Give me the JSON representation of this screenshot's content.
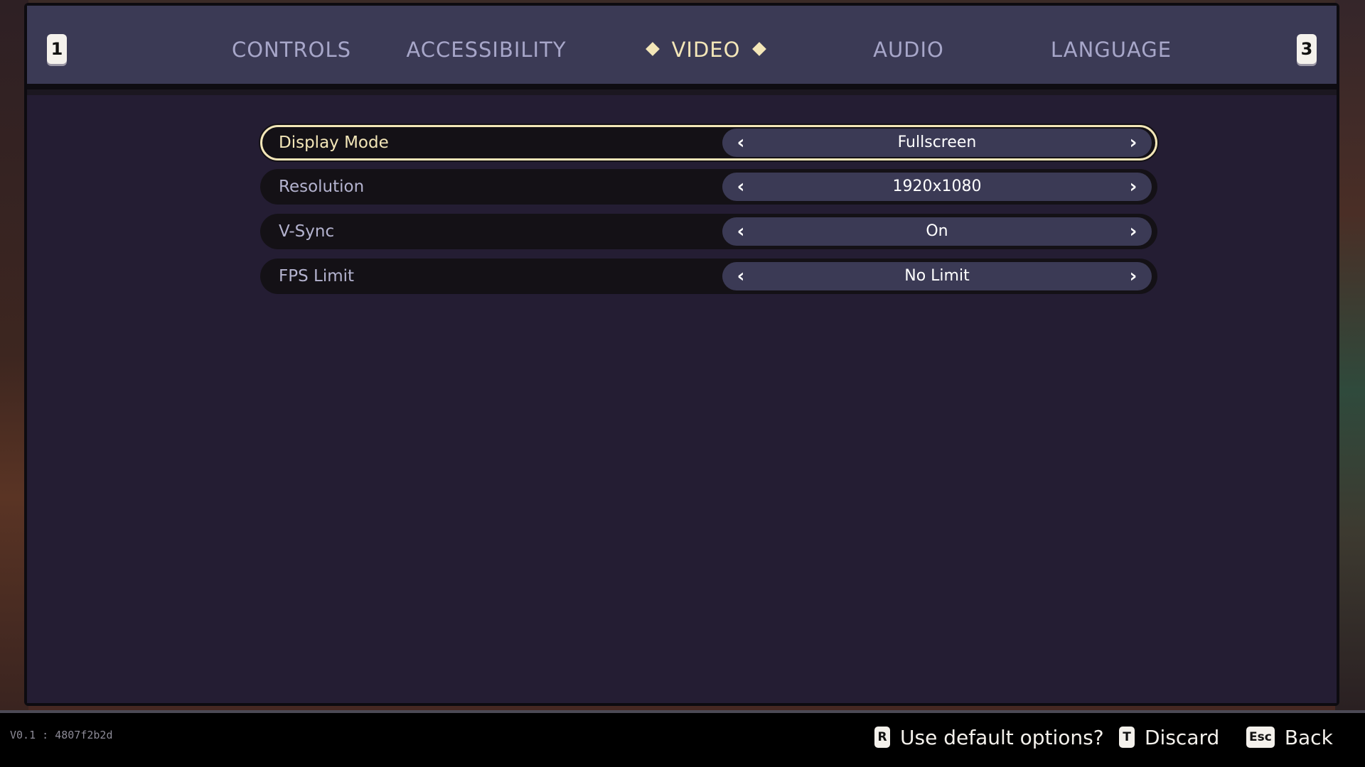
{
  "tabs": {
    "prev_key": "1",
    "next_key": "3",
    "items": [
      {
        "label": "CONTROLS"
      },
      {
        "label": "ACCESSIBILITY"
      },
      {
        "label": "VIDEO",
        "active": true
      },
      {
        "label": "AUDIO"
      },
      {
        "label": "LANGUAGE"
      }
    ]
  },
  "settings": [
    {
      "label": "Display Mode",
      "value": "Fullscreen",
      "selected": true
    },
    {
      "label": "Resolution",
      "value": "1920x1080"
    },
    {
      "label": "V-Sync",
      "value": "On"
    },
    {
      "label": "FPS Limit",
      "value": "No Limit"
    }
  ],
  "icons": {
    "left_arrow": "chevron-left-icon",
    "right_arrow": "chevron-right-icon",
    "active_tab_marker": "diamond-icon"
  },
  "footer": {
    "version": "V0.1 : 4807f2b2d",
    "hints": [
      {
        "key": "R",
        "label": "Use default options?"
      },
      {
        "key": "T",
        "label": "Discard"
      },
      {
        "key": "Esc",
        "label": "Back"
      }
    ]
  },
  "colors": {
    "accent": "#f3e6b8",
    "tab_inactive": "#a7a6c9",
    "tabbar_bg": "#3b3a55",
    "panel_bg": "#241d33",
    "row_bg": "#141116"
  }
}
